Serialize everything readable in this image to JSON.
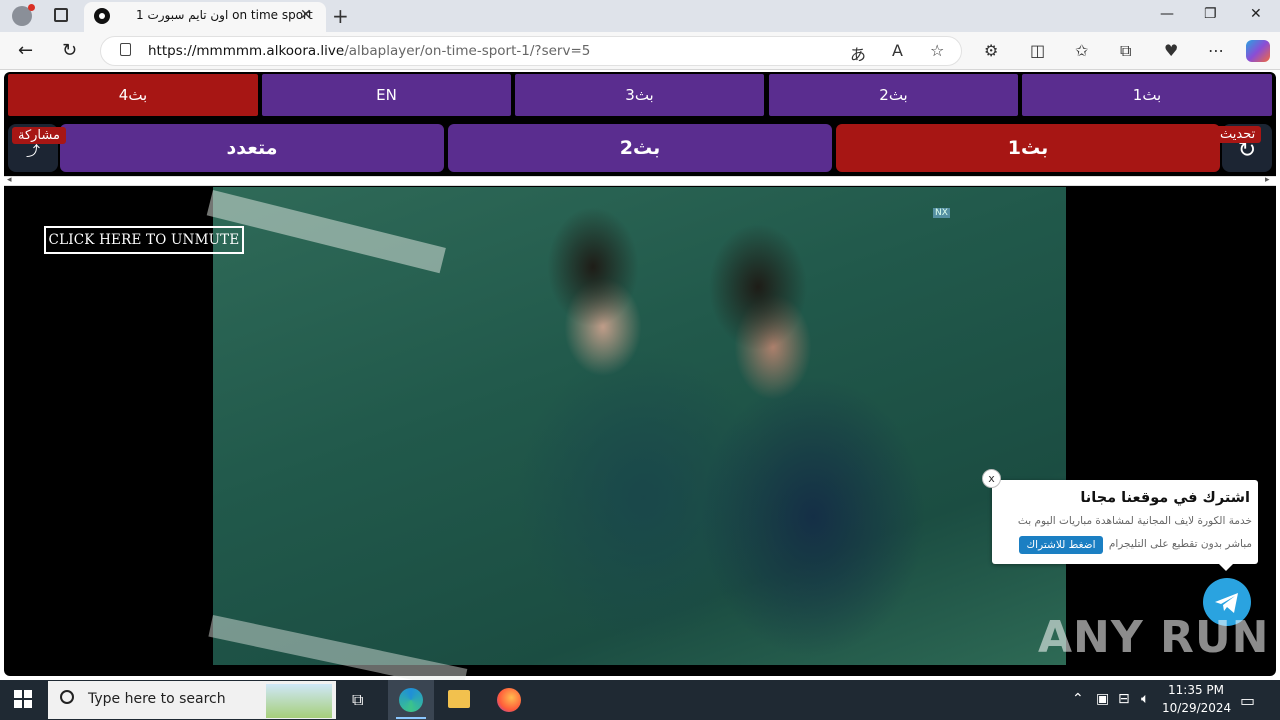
{
  "browser": {
    "tab_title": "اون تايم سبورت 1 on time sport",
    "url_host": "https://mmmmm.alkoora.live",
    "url_path": "/albaplayer/on-time-sport-1/?serv=5",
    "tab_close": "✕",
    "new_tab": "+",
    "window_controls": {
      "minimize": "—",
      "maximize": "❐",
      "close": "✕"
    },
    "toolbar_icons": [
      "translate-icon",
      "read-aloud-icon",
      "favorite-icon",
      "extensions-icon",
      "split-screen-icon",
      "favorites-icon",
      "collections-icon",
      "performance-icon",
      "more-icon",
      "copilot-icon"
    ]
  },
  "servers": {
    "row1": [
      {
        "label": "بث4",
        "active": true
      },
      {
        "label": "EN",
        "active": false
      },
      {
        "label": "بث3",
        "active": false
      },
      {
        "label": "بث2",
        "active": false
      },
      {
        "label": "بث1",
        "active": false
      }
    ],
    "row2": [
      {
        "label": "متعدد",
        "active": false
      },
      {
        "label": "بث2",
        "active": false
      },
      {
        "label": "بث1",
        "active": true
      }
    ],
    "refresh_label": "تحديث",
    "share_label": "مشاركة"
  },
  "player": {
    "unmute_label": "CLICK HERE TO UNMUTE",
    "video_watermark": "NX"
  },
  "popup": {
    "title": "اشترك في موقعنا مجانا",
    "line1": "خدمة الكورة لايف المجانية لمشاهدة مباريات اليوم بث",
    "line2": "مباشر بدون تقطيع على التليجرام",
    "cta": "اضغط للاشتراك",
    "close": "x"
  },
  "watermark": "ANY RUN",
  "taskbar": {
    "search_placeholder": "Type here to search",
    "time": "11:35 PM",
    "date": "10/29/2024"
  },
  "colors": {
    "purple": "#5a2d8f",
    "red": "#a71614",
    "telegram": "#2aa3e0"
  }
}
